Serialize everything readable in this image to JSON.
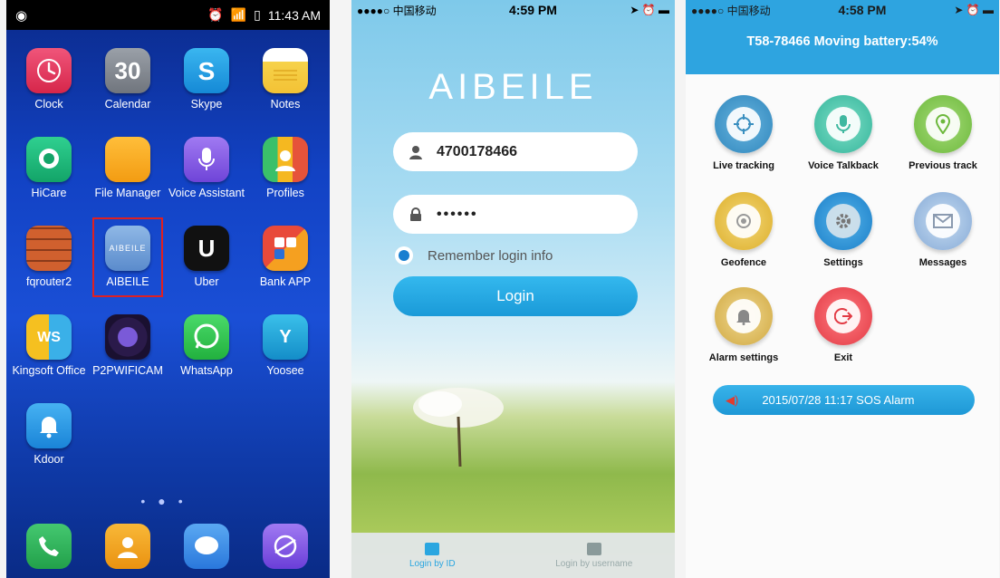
{
  "android": {
    "status_time": "11:43 AM",
    "apps": [
      {
        "label": "Clock",
        "icon": "clock-icon",
        "color": "#e8395a"
      },
      {
        "label": "Calendar",
        "icon": "calendar-icon",
        "color": "#8a8f98",
        "glyph": "30"
      },
      {
        "label": "Skype",
        "icon": "skype-icon",
        "color": "#1ea0e6",
        "glyph": "S"
      },
      {
        "label": "Notes",
        "icon": "notes-icon",
        "color": "#f6cc3a"
      },
      {
        "label": "HiCare",
        "icon": "hicare-icon",
        "color": "#1bb87a"
      },
      {
        "label": "File Manager",
        "icon": "folder-icon",
        "color": "#f5a61a"
      },
      {
        "label": "Voice Assistant",
        "icon": "microphone-icon",
        "color": "#8a5fe8"
      },
      {
        "label": "Profiles",
        "icon": "profiles-icon",
        "color": "#f08a2a"
      },
      {
        "label": "fqrouter2",
        "icon": "brick-wall-icon",
        "color": "#c4572a"
      },
      {
        "label": "AIBEILE",
        "icon": "aibeile-icon",
        "color": "#6f9fd8",
        "glyph": "AIBEILE"
      },
      {
        "label": "Uber",
        "icon": "uber-icon",
        "color": "#111111",
        "glyph": "U"
      },
      {
        "label": "Bank APP",
        "icon": "bank-icon",
        "color": "#e04a3a"
      },
      {
        "label": "Kingsoft Office",
        "icon": "kingsoft-icon",
        "color": "#f0c030",
        "glyph": "WS"
      },
      {
        "label": "P2PWIFICAM",
        "icon": "camera-icon",
        "color": "#3a2a6a"
      },
      {
        "label": "WhatsApp",
        "icon": "whatsapp-icon",
        "color": "#2dc54c"
      },
      {
        "label": "Yoosee",
        "icon": "yoosee-icon",
        "color": "#1fa5d8",
        "glyph": "Y"
      },
      {
        "label": "Kdoor",
        "icon": "bell-icon",
        "color": "#2a9be8"
      }
    ],
    "dock": [
      {
        "icon": "phone-icon",
        "color": "#2eb35a"
      },
      {
        "icon": "contacts-icon",
        "color": "#f0a020"
      },
      {
        "icon": "messages-icon",
        "color": "#3a8ee8"
      },
      {
        "icon": "browser-icon",
        "color": "#7a4ae0"
      }
    ]
  },
  "login": {
    "carrier": "●●●●○ 中国移动",
    "time": "4:59 PM",
    "brand": "AIBEILE",
    "username_value": "4700178466",
    "password_value": "••••••",
    "remember_label": "Remember login info",
    "login_button": "Login",
    "tabs": [
      "Login by ID",
      "Login by username"
    ]
  },
  "dashboard": {
    "carrier": "●●●●○ 中国移动",
    "time": "4:58 PM",
    "title": "T58-78466 Moving battery:54%",
    "features": [
      {
        "label": "Live tracking",
        "icon": "crosshair-icon",
        "color": "#3a8fc0"
      },
      {
        "label": "Voice Talkback",
        "icon": "microphone-icon",
        "color": "#3fb8a0"
      },
      {
        "label": "Previous track",
        "icon": "map-pin-icon",
        "color": "#7ac24a"
      },
      {
        "label": "Geofence",
        "icon": "geofence-icon",
        "color": "#e2b93a"
      },
      {
        "label": "Settings",
        "icon": "gear-icon",
        "color": "#2a8ed0"
      },
      {
        "label": "Messages",
        "icon": "envelope-icon",
        "color": "#8ab0d8"
      },
      {
        "label": "Alarm settings",
        "icon": "alarm-bell-icon",
        "color": "#d8b046"
      },
      {
        "label": "Exit",
        "icon": "exit-icon",
        "color": "#ea4a52"
      }
    ],
    "alarm_text": "2015/07/28 11:17 SOS Alarm"
  }
}
